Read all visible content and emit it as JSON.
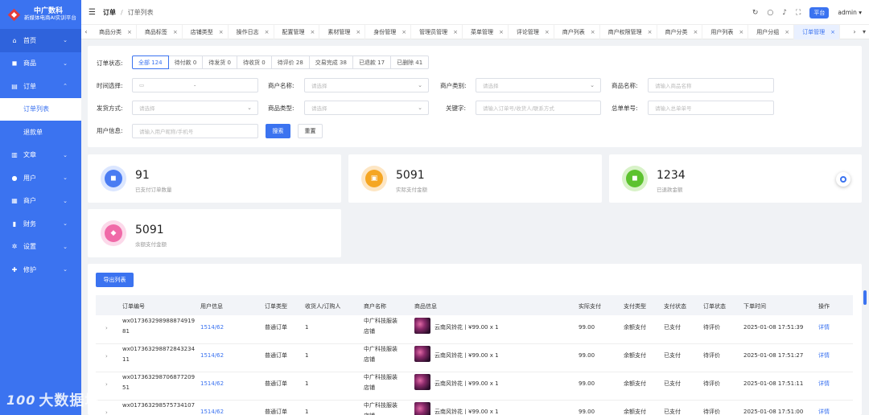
{
  "brand": {
    "title": "中广数科",
    "subtitle": "新媒体电商AI实训平台"
  },
  "sidebar": {
    "items": [
      {
        "label": "首页",
        "icon": "home-icon",
        "glyph": "⌂"
      },
      {
        "label": "商品",
        "icon": "bag-icon",
        "glyph": "◼"
      },
      {
        "label": "订单",
        "icon": "order-icon",
        "glyph": "▤"
      },
      {
        "label": "文章",
        "icon": "book-icon",
        "glyph": "▥"
      },
      {
        "label": "用户",
        "icon": "user-icon",
        "glyph": "●"
      },
      {
        "label": "商户",
        "icon": "store-icon",
        "glyph": "▦"
      },
      {
        "label": "财务",
        "icon": "finance-icon",
        "glyph": "▮"
      },
      {
        "label": "设置",
        "icon": "gear-icon",
        "glyph": "✲"
      },
      {
        "label": "修护",
        "icon": "repair-icon",
        "glyph": "✚"
      }
    ],
    "sub_items": [
      {
        "label": "订单列表"
      },
      {
        "label": "退款单"
      }
    ]
  },
  "header": {
    "section": "订单",
    "current": "订单列表",
    "platform": "平台",
    "user": "admin"
  },
  "tabs": [
    "商品分类",
    "商品标签",
    "店铺类型",
    "操作日志",
    "配置管理",
    "素材管理",
    "身份管理",
    "管理员管理",
    "菜单管理",
    "评论管理",
    "商户列表",
    "商户权限管理",
    "商户分类",
    "用户列表",
    "用户分组",
    "订单管理"
  ],
  "filter": {
    "status_label": "订单状态:",
    "status_pills": [
      "全部 124",
      "待付款 0",
      "待发货 0",
      "待收货 0",
      "待评价 28",
      "交易完成 38",
      "已退款 17",
      "已删除 41"
    ],
    "time_label": "时间选择:",
    "date_sep": "-",
    "merchant_name_label": "商户名称:",
    "merchant_name_ph": "请选择",
    "merchant_type_label": "商户类别:",
    "merchant_type_ph": "请选择",
    "goods_name_label": "商品名称:",
    "goods_name_ph": "请输入商品名称",
    "ship_label": "发货方式:",
    "ship_ph": "请选择",
    "goods_type_label": "商品类型:",
    "goods_type_ph": "请选择",
    "keyword_label": "关键字:",
    "keyword_ph": "请输入订单号/收货人/联系方式",
    "total_no_label": "总单单号:",
    "total_no_ph": "请输入总单单号",
    "user_info_label": "用户信息:",
    "user_info_ph": "请输入用户昵称/手机号",
    "search_btn": "搜索",
    "reset_btn": "重置"
  },
  "stats": [
    {
      "value": "91",
      "label": "已支付订单数量",
      "ring": "#dbe6ff",
      "core": "#4a7cf2",
      "glyph": "◼"
    },
    {
      "value": "5091",
      "label": "实际支付金额",
      "ring": "#fde6c4",
      "core": "#f5a623",
      "glyph": "▣"
    },
    {
      "value": "1234",
      "label": "已退款金额",
      "ring": "#d8f2c8",
      "core": "#5cc22e",
      "glyph": "◼"
    },
    {
      "value": "5091",
      "label": "余额支付金额",
      "ring": "#fcd9ea",
      "core": "#f06aa8",
      "glyph": "◆"
    }
  ],
  "table": {
    "export_btn": "导出列表",
    "headers": [
      "订单编号",
      "用户信息",
      "订单类型",
      "收货人/订购人",
      "商户名称",
      "商品信息",
      "实际支付",
      "支付类型",
      "支付状态",
      "订单状态",
      "下单时间",
      "操作"
    ],
    "rows": [
      {
        "no1": "wx017363298988874919",
        "no2": "81",
        "user": "1514/62",
        "type": "普通订单",
        "receiver": "1",
        "m1": "中广科技服装",
        "m2": "店铺",
        "goods": "云南风铃花丨¥99.00 x 1",
        "paid": "99.00",
        "pay_type": "余额支付",
        "pay_status": "已支付",
        "order_status": "待评价",
        "time": "2025-01-08 17:51:39",
        "action": "详情"
      },
      {
        "no1": "wx017363298872843234",
        "no2": "11",
        "user": "1514/62",
        "type": "普通订单",
        "receiver": "1",
        "m1": "中广科技服装",
        "m2": "店铺",
        "goods": "云南风铃花丨¥99.00 x 1",
        "paid": "99.00",
        "pay_type": "余额支付",
        "pay_status": "已支付",
        "order_status": "待评价",
        "time": "2025-01-08 17:51:27",
        "action": "详情"
      },
      {
        "no1": "wx017363298706877209",
        "no2": "51",
        "user": "1514/62",
        "type": "普通订单",
        "receiver": "1",
        "m1": "中广科技服装",
        "m2": "店铺",
        "goods": "云南风铃花丨¥99.00 x 1",
        "paid": "99.00",
        "pay_type": "余额支付",
        "pay_status": "已支付",
        "order_status": "待评价",
        "time": "2025-01-08 17:51:11",
        "action": "详情"
      },
      {
        "no1": "wx017363298575734107",
        "no2": "",
        "user": "1514/62",
        "type": "普通订单",
        "receiver": "1",
        "m1": "中广科技服装",
        "m2": "店铺",
        "goods": "云南风铃花丨¥99.00 x 1",
        "paid": "99.00",
        "pay_type": "余额支付",
        "pay_status": "已支付",
        "order_status": "待评价",
        "time": "2025-01-08 17:51:00",
        "action": "详情"
      }
    ]
  },
  "watermark": {
    "mark": "100",
    "text": "大数据境"
  }
}
